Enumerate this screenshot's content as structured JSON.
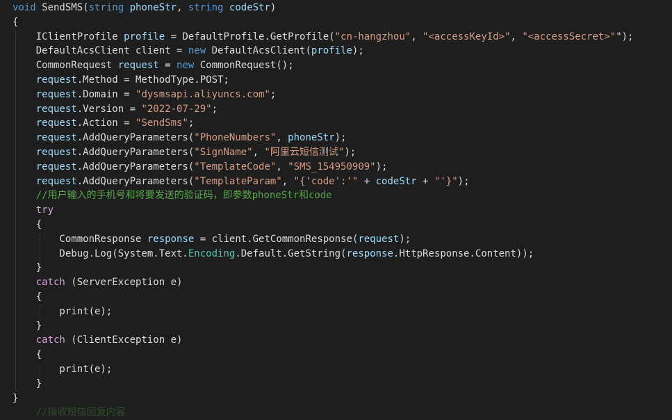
{
  "editor": {
    "language": "C#",
    "colors": {
      "background": "#1e1e1e",
      "keyword": "#569cd6",
      "control": "#d8a0df",
      "type": "#4ec9b0",
      "plain": "#dcdcdc",
      "variable": "#9cdcfe",
      "string": "#d69d85",
      "comment": "#57a64a"
    },
    "lines": [
      [
        [
          "kw",
          "void"
        ],
        [
          "pl",
          " SendSMS("
        ],
        [
          "kw",
          "string"
        ],
        [
          "pl",
          " "
        ],
        [
          "var",
          "phoneStr"
        ],
        [
          "pl",
          ", "
        ],
        [
          "kw",
          "string"
        ],
        [
          "pl",
          " "
        ],
        [
          "var",
          "codeStr"
        ],
        [
          "pl",
          ")"
        ]
      ],
      [
        [
          "pl",
          "{"
        ]
      ],
      [
        [
          "pl",
          "    IClientProfile "
        ],
        [
          "var",
          "profile"
        ],
        [
          "pl",
          " = DefaultProfile.GetProfile("
        ],
        [
          "str",
          "\"cn-hangzhou\""
        ],
        [
          "pl",
          ", "
        ],
        [
          "str",
          "\"<accessKeyId>\""
        ],
        [
          "pl",
          ", "
        ],
        [
          "str",
          "\"<accessSecret>\""
        ],
        [
          "pl",
          "\");"
        ]
      ],
      [
        [
          "pl",
          "    DefaultAcsClient client = "
        ],
        [
          "kw",
          "new"
        ],
        [
          "pl",
          " DefaultAcsClient("
        ],
        [
          "var",
          "profile"
        ],
        [
          "pl",
          ");"
        ]
      ],
      [
        [
          "pl",
          "    CommonRequest "
        ],
        [
          "var",
          "request"
        ],
        [
          "pl",
          " = "
        ],
        [
          "kw",
          "new"
        ],
        [
          "pl",
          " CommonRequest();"
        ]
      ],
      [
        [
          "var",
          "    request"
        ],
        [
          "pl",
          ".Method = MethodType.POST;"
        ]
      ],
      [
        [
          "var",
          "    request"
        ],
        [
          "pl",
          ".Domain = "
        ],
        [
          "str",
          "\"dysmsapi.aliyuncs.com\""
        ],
        [
          "pl",
          ";"
        ]
      ],
      [
        [
          "var",
          "    request"
        ],
        [
          "pl",
          ".Version = "
        ],
        [
          "str",
          "\"2022-07-29\""
        ],
        [
          "pl",
          ";"
        ]
      ],
      [
        [
          "var",
          "    request"
        ],
        [
          "pl",
          ".Action = "
        ],
        [
          "str",
          "\"SendSms\""
        ],
        [
          "pl",
          ";"
        ]
      ],
      [
        [
          "var",
          "    request"
        ],
        [
          "pl",
          ".AddQueryParameters("
        ],
        [
          "str",
          "\"PhoneNumbers\""
        ],
        [
          "pl",
          ", "
        ],
        [
          "var",
          "phoneStr"
        ],
        [
          "pl",
          ");"
        ]
      ],
      [
        [
          "var",
          "    request"
        ],
        [
          "pl",
          ".AddQueryParameters("
        ],
        [
          "str",
          "\"SignName\""
        ],
        [
          "pl",
          ", "
        ],
        [
          "str",
          "\"阿里云短信测试\""
        ],
        [
          "pl",
          ");"
        ]
      ],
      [
        [
          "var",
          "    request"
        ],
        [
          "pl",
          ".AddQueryParameters("
        ],
        [
          "str",
          "\"TemplateCode\""
        ],
        [
          "pl",
          ", "
        ],
        [
          "str",
          "\"SMS_154950909\""
        ],
        [
          "pl",
          ");"
        ]
      ],
      [
        [
          "var",
          "    request"
        ],
        [
          "pl",
          ".AddQueryParameters("
        ],
        [
          "str",
          "\"TemplateParam\""
        ],
        [
          "pl",
          ", "
        ],
        [
          "str",
          "\"{'code':'\""
        ],
        [
          "pl",
          " + "
        ],
        [
          "var",
          "codeStr"
        ],
        [
          "pl",
          " + "
        ],
        [
          "str",
          "\"'}\""
        ],
        [
          "pl",
          ");"
        ]
      ],
      [
        [
          "cm",
          "    //用户输入的手机号和将要发送的验证码，即参数phoneStr和code"
        ]
      ],
      [
        [
          "ctl",
          "    try"
        ]
      ],
      [
        [
          "pl",
          "    {"
        ]
      ],
      [
        [
          "pl",
          "        CommonResponse "
        ],
        [
          "var",
          "response"
        ],
        [
          "pl",
          " = client.GetCommonResponse("
        ],
        [
          "var",
          "request"
        ],
        [
          "pl",
          ");"
        ]
      ],
      [
        [
          "pl",
          "        Debug.Log(System.Text."
        ],
        [
          "ty",
          "Encoding"
        ],
        [
          "pl",
          ".Default.GetString("
        ],
        [
          "var",
          "response"
        ],
        [
          "pl",
          ".HttpResponse.Content));"
        ]
      ],
      [
        [
          "pl",
          "    }"
        ]
      ],
      [
        [
          "ctl",
          "    catch"
        ],
        [
          "pl",
          " (ServerException e)"
        ]
      ],
      [
        [
          "pl",
          "    {"
        ]
      ],
      [
        [
          "pl",
          "        print(e);"
        ]
      ],
      [
        [
          "pl",
          "    }"
        ]
      ],
      [
        [
          "ctl",
          "    catch"
        ],
        [
          "pl",
          " (ClientException e)"
        ]
      ],
      [
        [
          "pl",
          "    {"
        ]
      ],
      [
        [
          "pl",
          "        print(e);"
        ]
      ],
      [
        [
          "pl",
          "    }"
        ]
      ],
      [
        [
          "pl",
          "}"
        ]
      ],
      [
        [
          "cm",
          "    //接收短信回复内容 "
        ]
      ]
    ]
  }
}
